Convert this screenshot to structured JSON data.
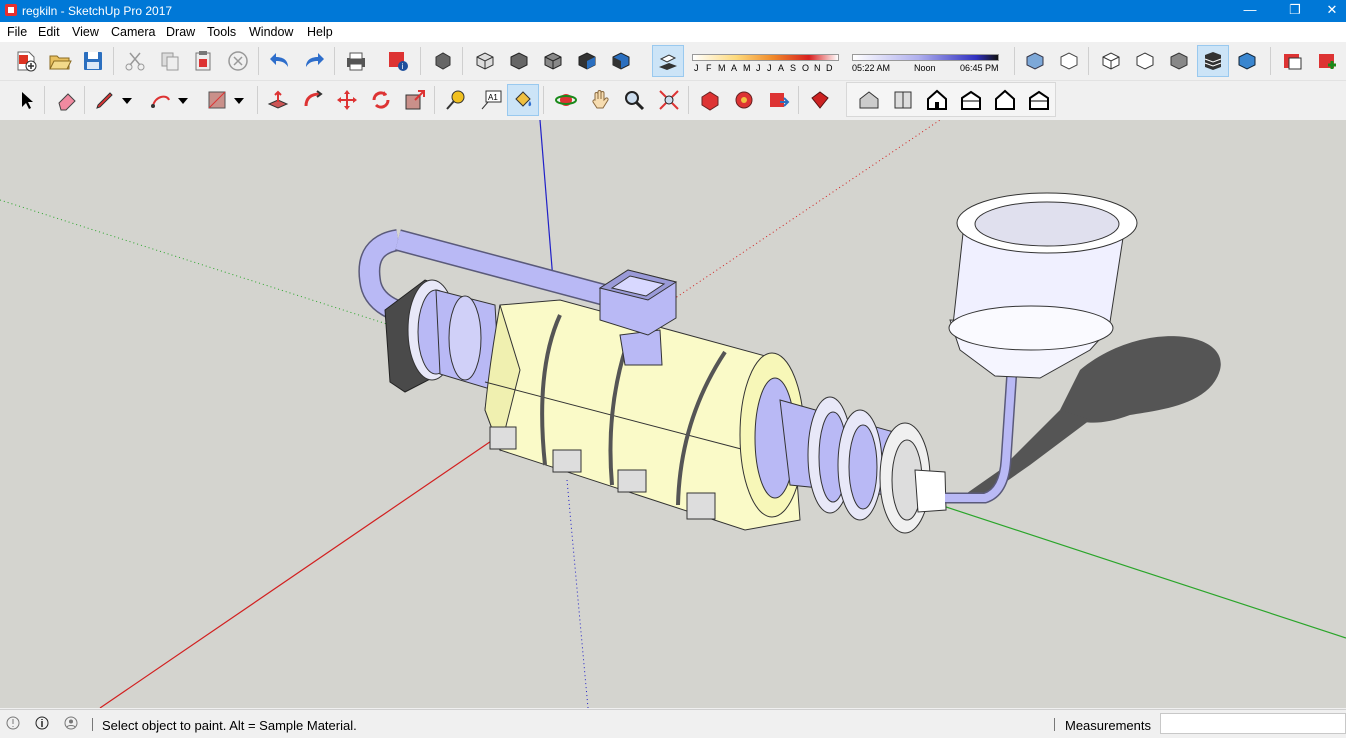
{
  "window": {
    "title": "regkiln - SketchUp Pro 2017",
    "minimize": "—",
    "maximize": "❐",
    "close": "✕"
  },
  "menu": [
    "File",
    "Edit",
    "View",
    "Camera",
    "Draw",
    "Tools",
    "Window",
    "Help"
  ],
  "shadows": {
    "months": [
      "J",
      "F",
      "M",
      "A",
      "M",
      "J",
      "J",
      "A",
      "S",
      "O",
      "N",
      "D"
    ],
    "time_start": "05:22 AM",
    "time_mid": "Noon",
    "time_end": "06:45 PM"
  },
  "status": {
    "message": "Select object to paint. Alt = Sample Material.",
    "measurements_label": "Measurements",
    "measurements_value": ""
  },
  "colors": {
    "titlebar": "#0078d7",
    "viewport": "#d4d4cf",
    "kiln_body": "#fafac8",
    "pipe": "#b9b9f5",
    "axis_red": "#d22020",
    "axis_green": "#2aa52a",
    "axis_blue": "#2020c8"
  }
}
